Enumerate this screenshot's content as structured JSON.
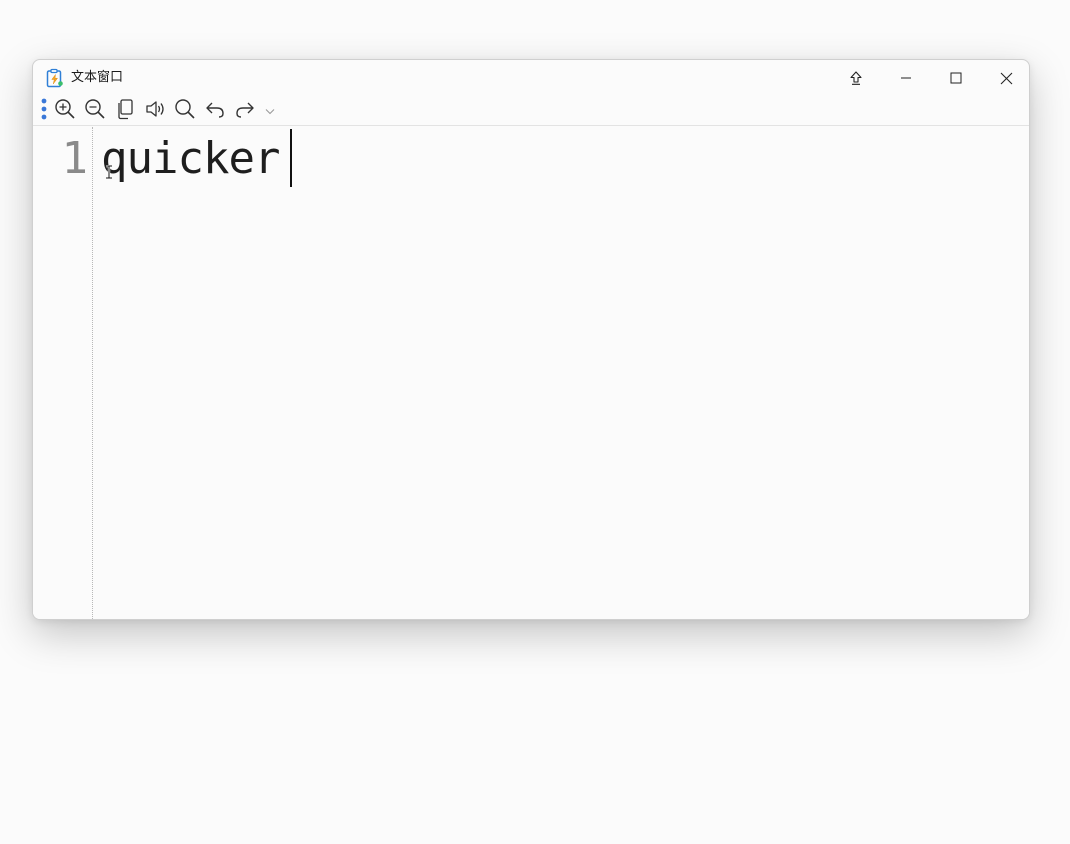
{
  "window": {
    "title": "文本窗口",
    "buttons": [
      "pin-top",
      "minimize",
      "maximize",
      "close"
    ]
  },
  "toolbar": {
    "items": [
      "more-icon",
      "zoom-in-icon",
      "zoom-out-icon",
      "copy-icon",
      "speaker-icon",
      "search-icon",
      "undo-icon",
      "redo-icon",
      "chevron-down-icon"
    ]
  },
  "editor": {
    "line_number": "1",
    "text": "quicker"
  },
  "colors": {
    "accent": "#3a78d8",
    "text": "#1e1e1e",
    "line_number": "#8a8a8a"
  }
}
